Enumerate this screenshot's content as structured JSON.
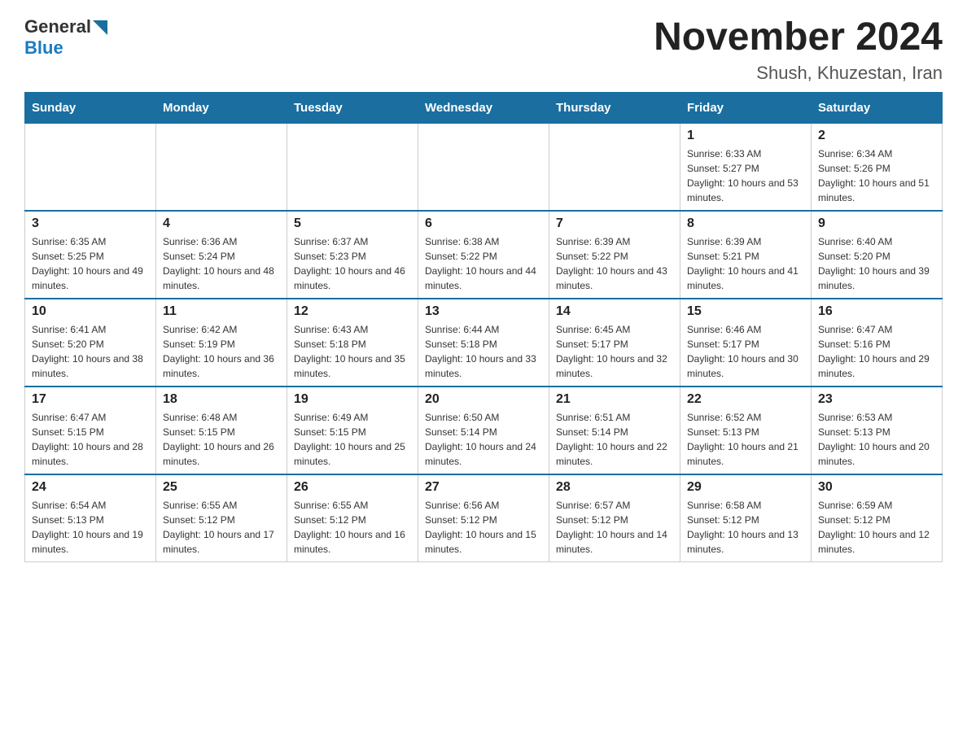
{
  "logo": {
    "general": "General",
    "blue": "Blue"
  },
  "header": {
    "month_year": "November 2024",
    "location": "Shush, Khuzestan, Iran"
  },
  "weekdays": [
    "Sunday",
    "Monday",
    "Tuesday",
    "Wednesday",
    "Thursday",
    "Friday",
    "Saturday"
  ],
  "weeks": [
    [
      {
        "day": "",
        "info": ""
      },
      {
        "day": "",
        "info": ""
      },
      {
        "day": "",
        "info": ""
      },
      {
        "day": "",
        "info": ""
      },
      {
        "day": "",
        "info": ""
      },
      {
        "day": "1",
        "info": "Sunrise: 6:33 AM\nSunset: 5:27 PM\nDaylight: 10 hours and 53 minutes."
      },
      {
        "day": "2",
        "info": "Sunrise: 6:34 AM\nSunset: 5:26 PM\nDaylight: 10 hours and 51 minutes."
      }
    ],
    [
      {
        "day": "3",
        "info": "Sunrise: 6:35 AM\nSunset: 5:25 PM\nDaylight: 10 hours and 49 minutes."
      },
      {
        "day": "4",
        "info": "Sunrise: 6:36 AM\nSunset: 5:24 PM\nDaylight: 10 hours and 48 minutes."
      },
      {
        "day": "5",
        "info": "Sunrise: 6:37 AM\nSunset: 5:23 PM\nDaylight: 10 hours and 46 minutes."
      },
      {
        "day": "6",
        "info": "Sunrise: 6:38 AM\nSunset: 5:22 PM\nDaylight: 10 hours and 44 minutes."
      },
      {
        "day": "7",
        "info": "Sunrise: 6:39 AM\nSunset: 5:22 PM\nDaylight: 10 hours and 43 minutes."
      },
      {
        "day": "8",
        "info": "Sunrise: 6:39 AM\nSunset: 5:21 PM\nDaylight: 10 hours and 41 minutes."
      },
      {
        "day": "9",
        "info": "Sunrise: 6:40 AM\nSunset: 5:20 PM\nDaylight: 10 hours and 39 minutes."
      }
    ],
    [
      {
        "day": "10",
        "info": "Sunrise: 6:41 AM\nSunset: 5:20 PM\nDaylight: 10 hours and 38 minutes."
      },
      {
        "day": "11",
        "info": "Sunrise: 6:42 AM\nSunset: 5:19 PM\nDaylight: 10 hours and 36 minutes."
      },
      {
        "day": "12",
        "info": "Sunrise: 6:43 AM\nSunset: 5:18 PM\nDaylight: 10 hours and 35 minutes."
      },
      {
        "day": "13",
        "info": "Sunrise: 6:44 AM\nSunset: 5:18 PM\nDaylight: 10 hours and 33 minutes."
      },
      {
        "day": "14",
        "info": "Sunrise: 6:45 AM\nSunset: 5:17 PM\nDaylight: 10 hours and 32 minutes."
      },
      {
        "day": "15",
        "info": "Sunrise: 6:46 AM\nSunset: 5:17 PM\nDaylight: 10 hours and 30 minutes."
      },
      {
        "day": "16",
        "info": "Sunrise: 6:47 AM\nSunset: 5:16 PM\nDaylight: 10 hours and 29 minutes."
      }
    ],
    [
      {
        "day": "17",
        "info": "Sunrise: 6:47 AM\nSunset: 5:15 PM\nDaylight: 10 hours and 28 minutes."
      },
      {
        "day": "18",
        "info": "Sunrise: 6:48 AM\nSunset: 5:15 PM\nDaylight: 10 hours and 26 minutes."
      },
      {
        "day": "19",
        "info": "Sunrise: 6:49 AM\nSunset: 5:15 PM\nDaylight: 10 hours and 25 minutes."
      },
      {
        "day": "20",
        "info": "Sunrise: 6:50 AM\nSunset: 5:14 PM\nDaylight: 10 hours and 24 minutes."
      },
      {
        "day": "21",
        "info": "Sunrise: 6:51 AM\nSunset: 5:14 PM\nDaylight: 10 hours and 22 minutes."
      },
      {
        "day": "22",
        "info": "Sunrise: 6:52 AM\nSunset: 5:13 PM\nDaylight: 10 hours and 21 minutes."
      },
      {
        "day": "23",
        "info": "Sunrise: 6:53 AM\nSunset: 5:13 PM\nDaylight: 10 hours and 20 minutes."
      }
    ],
    [
      {
        "day": "24",
        "info": "Sunrise: 6:54 AM\nSunset: 5:13 PM\nDaylight: 10 hours and 19 minutes."
      },
      {
        "day": "25",
        "info": "Sunrise: 6:55 AM\nSunset: 5:12 PM\nDaylight: 10 hours and 17 minutes."
      },
      {
        "day": "26",
        "info": "Sunrise: 6:55 AM\nSunset: 5:12 PM\nDaylight: 10 hours and 16 minutes."
      },
      {
        "day": "27",
        "info": "Sunrise: 6:56 AM\nSunset: 5:12 PM\nDaylight: 10 hours and 15 minutes."
      },
      {
        "day": "28",
        "info": "Sunrise: 6:57 AM\nSunset: 5:12 PM\nDaylight: 10 hours and 14 minutes."
      },
      {
        "day": "29",
        "info": "Sunrise: 6:58 AM\nSunset: 5:12 PM\nDaylight: 10 hours and 13 minutes."
      },
      {
        "day": "30",
        "info": "Sunrise: 6:59 AM\nSunset: 5:12 PM\nDaylight: 10 hours and 12 minutes."
      }
    ]
  ]
}
